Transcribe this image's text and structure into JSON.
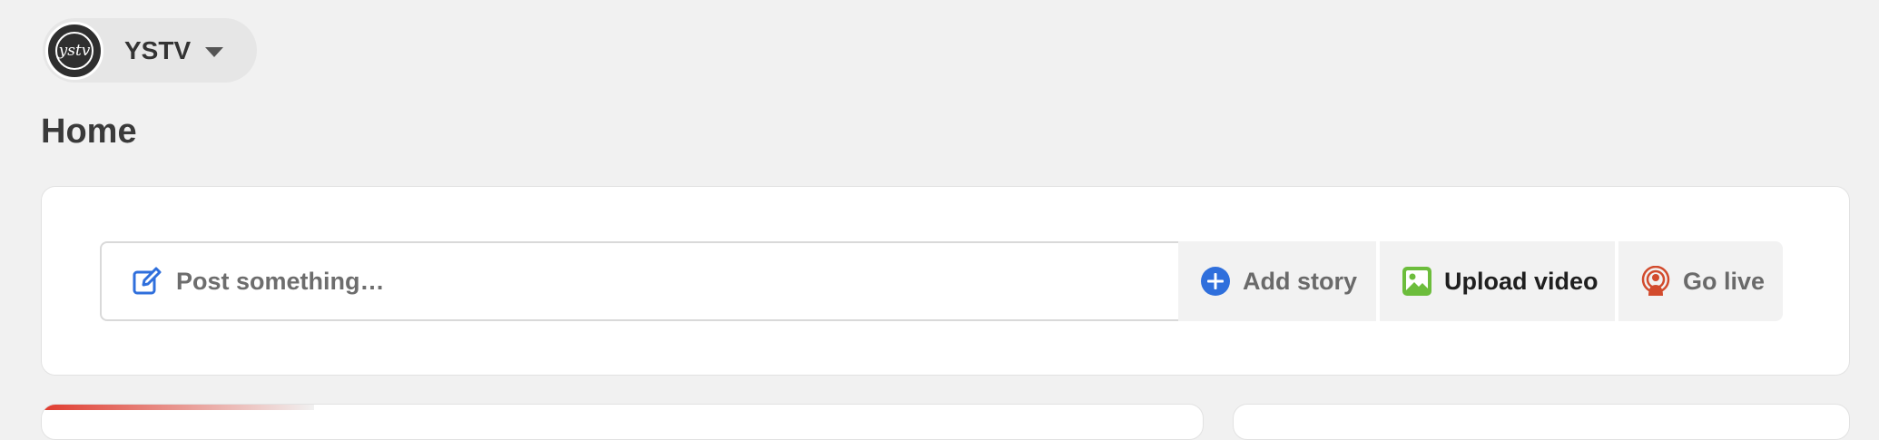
{
  "account": {
    "name": "YSTV",
    "avatar_text": "ystv"
  },
  "page": {
    "title": "Home"
  },
  "composer": {
    "placeholder": "Post something…",
    "actions": [
      {
        "label": "Add story",
        "icon": "add-circle-icon",
        "color": "#2f6fdc"
      },
      {
        "label": "Upload video",
        "icon": "image-icon",
        "color": "#6cbd3c"
      },
      {
        "label": "Go live",
        "icon": "live-broadcast-icon",
        "color": "#d24b2d"
      }
    ],
    "edit_icon": "edit-icon",
    "accent_color": "#2f6fdc"
  },
  "colors": {
    "background": "#f1f1f1",
    "card": "#ffffff",
    "button_bg": "#f2f2f2"
  }
}
